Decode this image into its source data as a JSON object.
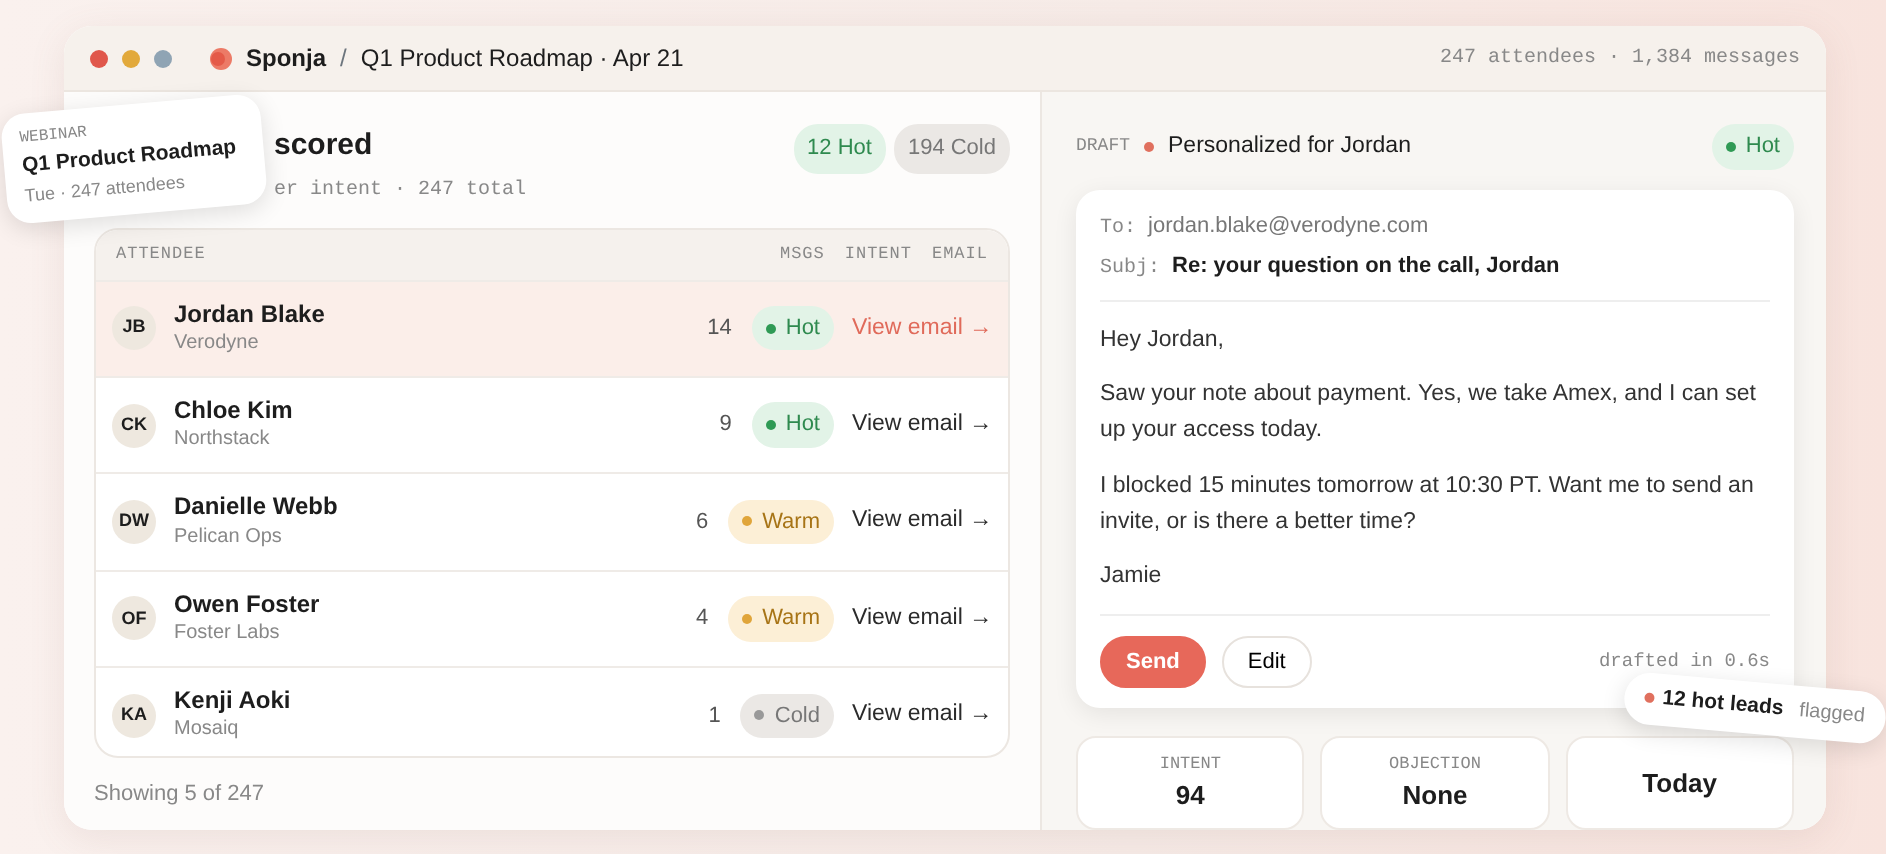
{
  "window": {
    "controls": [
      {
        "color": "#e0574b"
      },
      {
        "color": "#e2a93b"
      },
      {
        "color": "#8fa4b4"
      }
    ],
    "brand": "Sponja",
    "separator": "/",
    "title": "Q1 Product Roadmap · Apr 21",
    "summary": "247 attendees · 1,384 messages"
  },
  "list": {
    "heading": "scored",
    "subheading": "er intent · 247 total",
    "counts": [
      {
        "label": "12 Hot",
        "kind": "hot"
      },
      {
        "label": "194 Cold",
        "kind": "cold"
      }
    ],
    "columns": [
      "ATTENDEE",
      "MSGS",
      "INTENT",
      "EMAIL"
    ],
    "rows": [
      {
        "initials": "JB",
        "name": "Jordan Blake",
        "company": "Verodyne",
        "msgs": "14",
        "intent": {
          "label": "Hot",
          "kind": "hot"
        },
        "link": "View email →",
        "selected": true
      },
      {
        "initials": "CK",
        "name": "Chloe Kim",
        "company": "Northstack",
        "msgs": "9",
        "intent": {
          "label": "Hot",
          "kind": "hot"
        },
        "link": "View email →",
        "selected": false
      },
      {
        "initials": "DW",
        "name": "Danielle Webb",
        "company": "Pelican Ops",
        "msgs": "6",
        "intent": {
          "label": "Warm",
          "kind": "warm"
        },
        "link": "View email →",
        "selected": false
      },
      {
        "initials": "OF",
        "name": "Owen Foster",
        "company": "Foster Labs",
        "msgs": "4",
        "intent": {
          "label": "Warm",
          "kind": "warm"
        },
        "link": "View email →",
        "selected": false
      },
      {
        "initials": "KA",
        "name": "Kenji Aoki",
        "company": "Mosaiq",
        "msgs": "1",
        "intent": {
          "label": "Cold",
          "kind": "cold"
        },
        "link": "View email →",
        "selected": false
      }
    ],
    "footer": "Showing 5 of 247"
  },
  "draft": {
    "label": "DRAFT",
    "title": "Personalized for Jordan",
    "intent": {
      "label": "Hot",
      "kind": "hot"
    },
    "to_label": "To:",
    "to": "jordan.blake@verodyne.com",
    "subject_label": "Subj:",
    "subject": "Re: your question on the call, Jordan",
    "body": [
      "Hey Jordan,",
      "Saw your note about payment. Yes, we take Amex, and I can set up your access today.",
      "I blocked 15 minutes tomorrow at 10:30 PT. Want me to send an invite, or is there a better time?",
      "Jamie"
    ],
    "buttons": [
      {
        "label": "Send",
        "kind": "primary"
      },
      {
        "label": "Edit",
        "kind": "secondary"
      }
    ],
    "timing": "drafted in 0.6s"
  },
  "stats": [
    {
      "label": "INTENT",
      "value": "94"
    },
    {
      "label": "OBJECTION",
      "value": "None"
    },
    {
      "value": "Today"
    }
  ],
  "webinar_card": {
    "eyebrow": "WEBINAR",
    "title": "Q1 Product Roadmap",
    "meta": "Tue · 247 attendees"
  },
  "toast": {
    "title": "12 hot leads",
    "note": "flagged"
  }
}
